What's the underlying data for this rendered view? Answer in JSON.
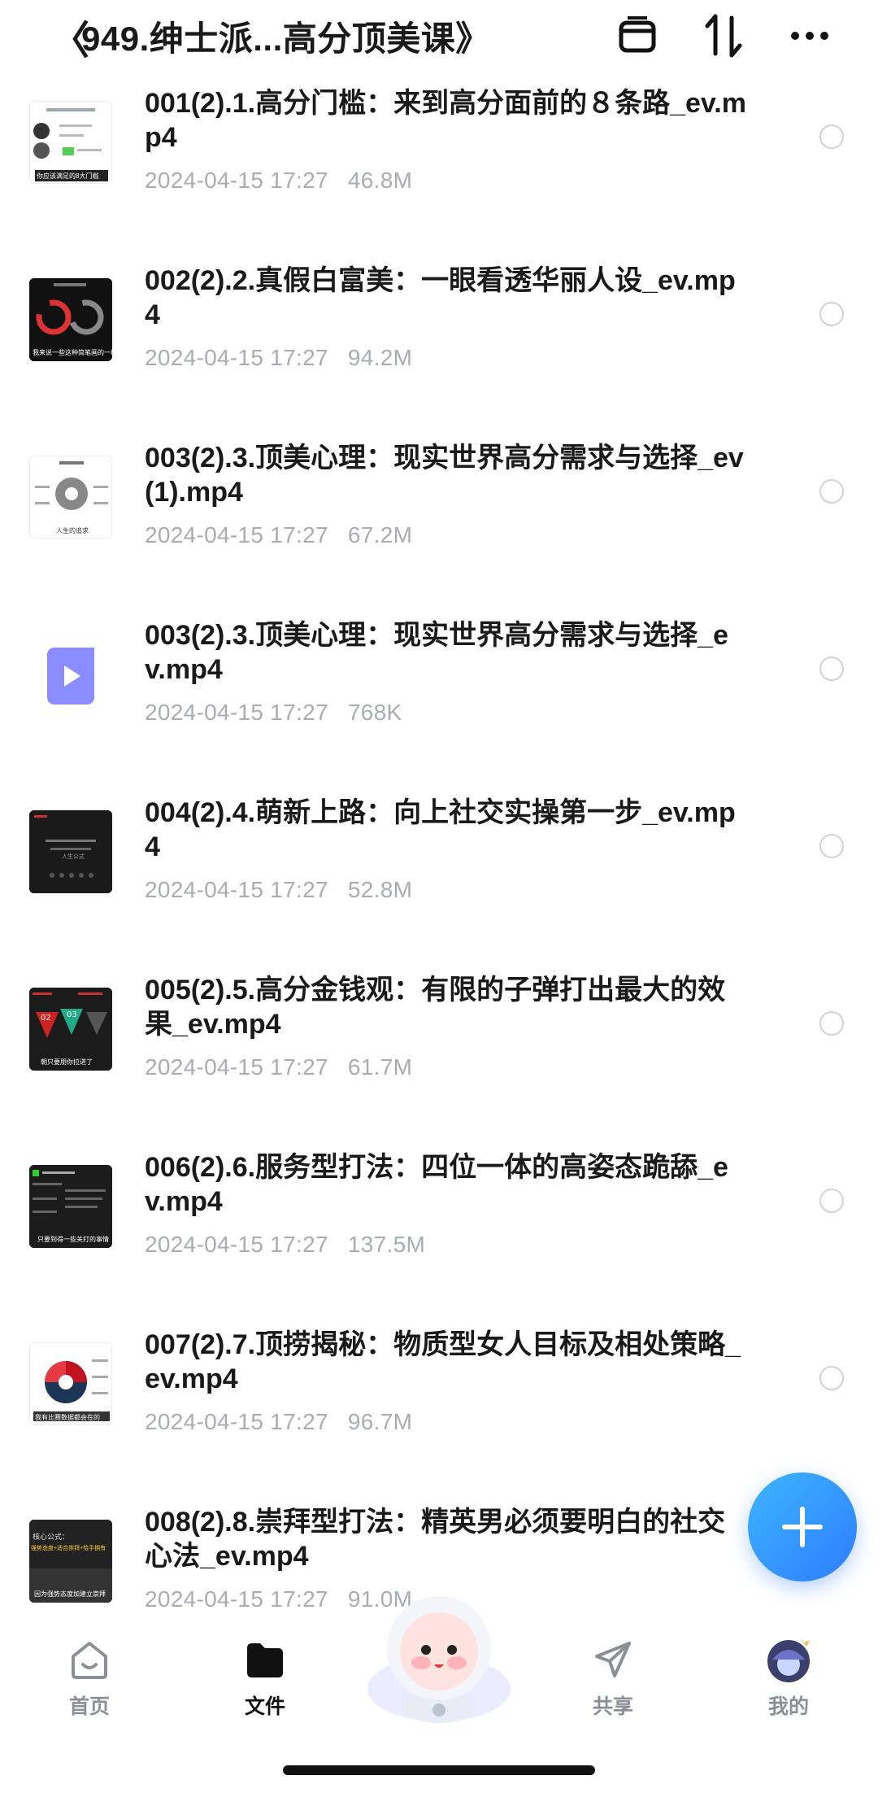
{
  "header": {
    "back_glyph": "〈",
    "title": "949.绅士派...高分顶美课》",
    "icons": [
      "archive-icon",
      "sort-icon",
      "more-icon"
    ]
  },
  "files": [
    {
      "name": "001(2).1.高分门槛：来到高分面前的８条路_ev.mp4",
      "date": "2024-04-15 17:27",
      "size": "46.8M",
      "thumb": "white-slide"
    },
    {
      "name": "002(2).2.真假白富美：一眼看透华丽人设_ev.mp4",
      "date": "2024-04-15 17:27",
      "size": "94.2M",
      "thumb": "dark-rings"
    },
    {
      "name": "003(2).3.顶美心理：现实世界高分需求与选择_ev (1).mp4",
      "date": "2024-04-15 17:27",
      "size": "67.2M",
      "thumb": "white-diagram"
    },
    {
      "name": "003(2).3.顶美心理：现实世界高分需求与选择_ev.mp4",
      "date": "2024-04-15 17:27",
      "size": "768K",
      "thumb": "video-icon"
    },
    {
      "name": "004(2).4.萌新上路：向上社交实操第一步_ev.mp4",
      "date": "2024-04-15 17:27",
      "size": "52.8M",
      "thumb": "dark-slide"
    },
    {
      "name": "005(2).5.高分金钱观：有限的子弹打出最大的效果_ev.mp4",
      "date": "2024-04-15 17:27",
      "size": "61.7M",
      "thumb": "dark-triangles"
    },
    {
      "name": "006(2).6.服务型打法：四位一体的高姿态跪舔_ev.mp4",
      "date": "2024-04-15 17:27",
      "size": "137.5M",
      "thumb": "dark-text"
    },
    {
      "name": "007(2).7.顶捞揭秘：物质型女人目标及相处策略_ev.mp4",
      "date": "2024-04-15 17:27",
      "size": "96.7M",
      "thumb": "white-circle"
    },
    {
      "name": "008(2).8.崇拜型打法：精英男必须要明白的社交心法_ev.mp4",
      "date": "2024-04-15 17:27",
      "size": "91.0M",
      "thumb": "dark-city"
    }
  ],
  "thumb_captions": {
    "t1": "你应该满足的8大门槛",
    "t2": "我来说一些这种简笔画的一种",
    "t3": "人生的追求",
    "t5": "人生公式",
    "t6": "朝只要朋你拉进了",
    "t7": "只要到得一些关打的事情",
    "t8": "我有比赛数据都会在的",
    "t9a": "核心公式：",
    "t9b": "强势态度+适合崇拜+恰手拥有",
    "t9c": "因为强势态度加建立崇拜"
  },
  "tabbar": {
    "tabs": [
      {
        "label": "首页",
        "icon": "home-icon"
      },
      {
        "label": "文件",
        "icon": "folder-icon",
        "active": true
      },
      {
        "label": "共享",
        "icon": "send-icon"
      },
      {
        "label": "我的",
        "icon": "avatar"
      }
    ]
  },
  "colors": {
    "accent": "#2f7dff",
    "meta_text": "#a9acb3",
    "video_icon": "#8a8cff"
  }
}
